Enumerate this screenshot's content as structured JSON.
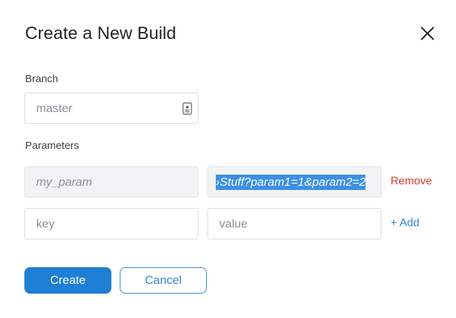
{
  "dialog": {
    "title": "Create a New Build",
    "close_icon": "close-icon"
  },
  "branch": {
    "label": "Branch",
    "value": "master",
    "icon": "branch-list-icon"
  },
  "parameters": {
    "label": "Parameters",
    "rows": [
      {
        "key": "my_param",
        "value": "›Stuff?param1=1&param2=2",
        "action": "Remove"
      }
    ],
    "new_row": {
      "key_placeholder": "key",
      "value_placeholder": "value",
      "action": "+ Add"
    }
  },
  "actions": {
    "create_label": "Create",
    "cancel_label": "Cancel"
  },
  "colors": {
    "primary": "#1f7fd4",
    "remove": "#d33a2c",
    "selection": "#3b8fe5"
  }
}
